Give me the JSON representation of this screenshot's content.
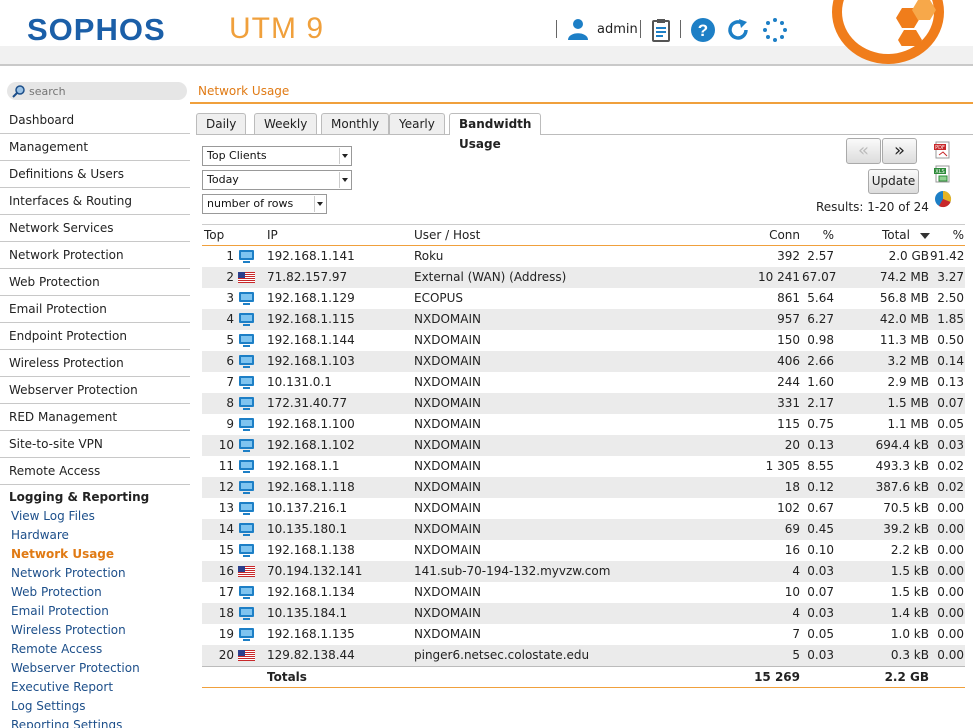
{
  "header": {
    "logo": "SOPHOS",
    "product": "UTM 9",
    "user": "admin"
  },
  "search": {
    "placeholder": "search"
  },
  "page_title": "Network Usage",
  "sidebar": {
    "items": [
      "Dashboard",
      "Management",
      "Definitions & Users",
      "Interfaces & Routing",
      "Network Services",
      "Network Protection",
      "Web Protection",
      "Email Protection",
      "Endpoint Protection",
      "Wireless Protection",
      "Webserver Protection",
      "RED Management",
      "Site-to-site VPN",
      "Remote Access"
    ],
    "section": "Logging & Reporting",
    "sub_items": [
      "View Log Files",
      "Hardware",
      "Network Usage",
      "Network Protection",
      "Web Protection",
      "Email Protection",
      "Wireless Protection",
      "Remote Access",
      "Webserver Protection",
      "Executive Report",
      "Log Settings",
      "Reporting Settings"
    ],
    "active_sub": "Network Usage"
  },
  "tabs": [
    "Daily",
    "Weekly",
    "Monthly",
    "Yearly",
    "Bandwidth Usage"
  ],
  "active_tab": "Bandwidth Usage",
  "controls": {
    "clients_select": "Top Clients",
    "period_select": "Today",
    "rows_select": "number of rows",
    "prev": "«",
    "next": "»",
    "update": "Update",
    "results": "Results: 1-20 of 24"
  },
  "table": {
    "columns": [
      "Top",
      "IP",
      "User / Host",
      "Conn",
      "%",
      "Total",
      "%"
    ],
    "rows": [
      {
        "top": "1",
        "icon": "pc",
        "ip": "192.168.1.141",
        "host": "Roku",
        "conn": "392",
        "conn_pct": "2.57",
        "total": "2.0 GB",
        "total_pct": "91.42"
      },
      {
        "top": "2",
        "icon": "us-flag",
        "ip": "71.82.157.97",
        "host": "External (WAN) (Address)",
        "conn": "10 241",
        "conn_pct": "67.07",
        "total": "74.2 MB",
        "total_pct": "3.27"
      },
      {
        "top": "3",
        "icon": "pc",
        "ip": "192.168.1.129",
        "host": "ECOPUS",
        "conn": "861",
        "conn_pct": "5.64",
        "total": "56.8 MB",
        "total_pct": "2.50"
      },
      {
        "top": "4",
        "icon": "pc",
        "ip": "192.168.1.115",
        "host": "NXDOMAIN",
        "conn": "957",
        "conn_pct": "6.27",
        "total": "42.0 MB",
        "total_pct": "1.85"
      },
      {
        "top": "5",
        "icon": "pc",
        "ip": "192.168.1.144",
        "host": "NXDOMAIN",
        "conn": "150",
        "conn_pct": "0.98",
        "total": "11.3 MB",
        "total_pct": "0.50"
      },
      {
        "top": "6",
        "icon": "pc",
        "ip": "192.168.1.103",
        "host": "NXDOMAIN",
        "conn": "406",
        "conn_pct": "2.66",
        "total": "3.2 MB",
        "total_pct": "0.14"
      },
      {
        "top": "7",
        "icon": "pc",
        "ip": "10.131.0.1",
        "host": "NXDOMAIN",
        "conn": "244",
        "conn_pct": "1.60",
        "total": "2.9 MB",
        "total_pct": "0.13"
      },
      {
        "top": "8",
        "icon": "pc",
        "ip": "172.31.40.77",
        "host": "NXDOMAIN",
        "conn": "331",
        "conn_pct": "2.17",
        "total": "1.5 MB",
        "total_pct": "0.07"
      },
      {
        "top": "9",
        "icon": "pc",
        "ip": "192.168.1.100",
        "host": "NXDOMAIN",
        "conn": "115",
        "conn_pct": "0.75",
        "total": "1.1 MB",
        "total_pct": "0.05"
      },
      {
        "top": "10",
        "icon": "pc",
        "ip": "192.168.1.102",
        "host": "NXDOMAIN",
        "conn": "20",
        "conn_pct": "0.13",
        "total": "694.4 kB",
        "total_pct": "0.03"
      },
      {
        "top": "11",
        "icon": "pc",
        "ip": "192.168.1.1",
        "host": "NXDOMAIN",
        "conn": "1 305",
        "conn_pct": "8.55",
        "total": "493.3 kB",
        "total_pct": "0.02"
      },
      {
        "top": "12",
        "icon": "pc",
        "ip": "192.168.1.118",
        "host": "NXDOMAIN",
        "conn": "18",
        "conn_pct": "0.12",
        "total": "387.6 kB",
        "total_pct": "0.02"
      },
      {
        "top": "13",
        "icon": "pc",
        "ip": "10.137.216.1",
        "host": "NXDOMAIN",
        "conn": "102",
        "conn_pct": "0.67",
        "total": "70.5 kB",
        "total_pct": "0.00"
      },
      {
        "top": "14",
        "icon": "pc",
        "ip": "10.135.180.1",
        "host": "NXDOMAIN",
        "conn": "69",
        "conn_pct": "0.45",
        "total": "39.2 kB",
        "total_pct": "0.00"
      },
      {
        "top": "15",
        "icon": "pc",
        "ip": "192.168.1.138",
        "host": "NXDOMAIN",
        "conn": "16",
        "conn_pct": "0.10",
        "total": "2.2 kB",
        "total_pct": "0.00"
      },
      {
        "top": "16",
        "icon": "us-flag",
        "ip": "70.194.132.141",
        "host": "141.sub-70-194-132.myvzw.com",
        "conn": "4",
        "conn_pct": "0.03",
        "total": "1.5 kB",
        "total_pct": "0.00"
      },
      {
        "top": "17",
        "icon": "pc",
        "ip": "192.168.1.134",
        "host": "NXDOMAIN",
        "conn": "10",
        "conn_pct": "0.07",
        "total": "1.5 kB",
        "total_pct": "0.00"
      },
      {
        "top": "18",
        "icon": "pc",
        "ip": "10.135.184.1",
        "host": "NXDOMAIN",
        "conn": "4",
        "conn_pct": "0.03",
        "total": "1.4 kB",
        "total_pct": "0.00"
      },
      {
        "top": "19",
        "icon": "pc",
        "ip": "192.168.1.135",
        "host": "NXDOMAIN",
        "conn": "7",
        "conn_pct": "0.05",
        "total": "1.0 kB",
        "total_pct": "0.00"
      },
      {
        "top": "20",
        "icon": "us-flag",
        "ip": "129.82.138.44",
        "host": "pinger6.netsec.colostate.edu",
        "conn": "5",
        "conn_pct": "0.03",
        "total": "0.3 kB",
        "total_pct": "0.00"
      }
    ],
    "totals": {
      "label": "Totals",
      "conn": "15 269",
      "total": "2.2 GB"
    }
  },
  "colors": {
    "brand_blue": "#1b5fa8",
    "accent_orange": "#f07d1b",
    "link_blue": "#1d4f8a"
  }
}
